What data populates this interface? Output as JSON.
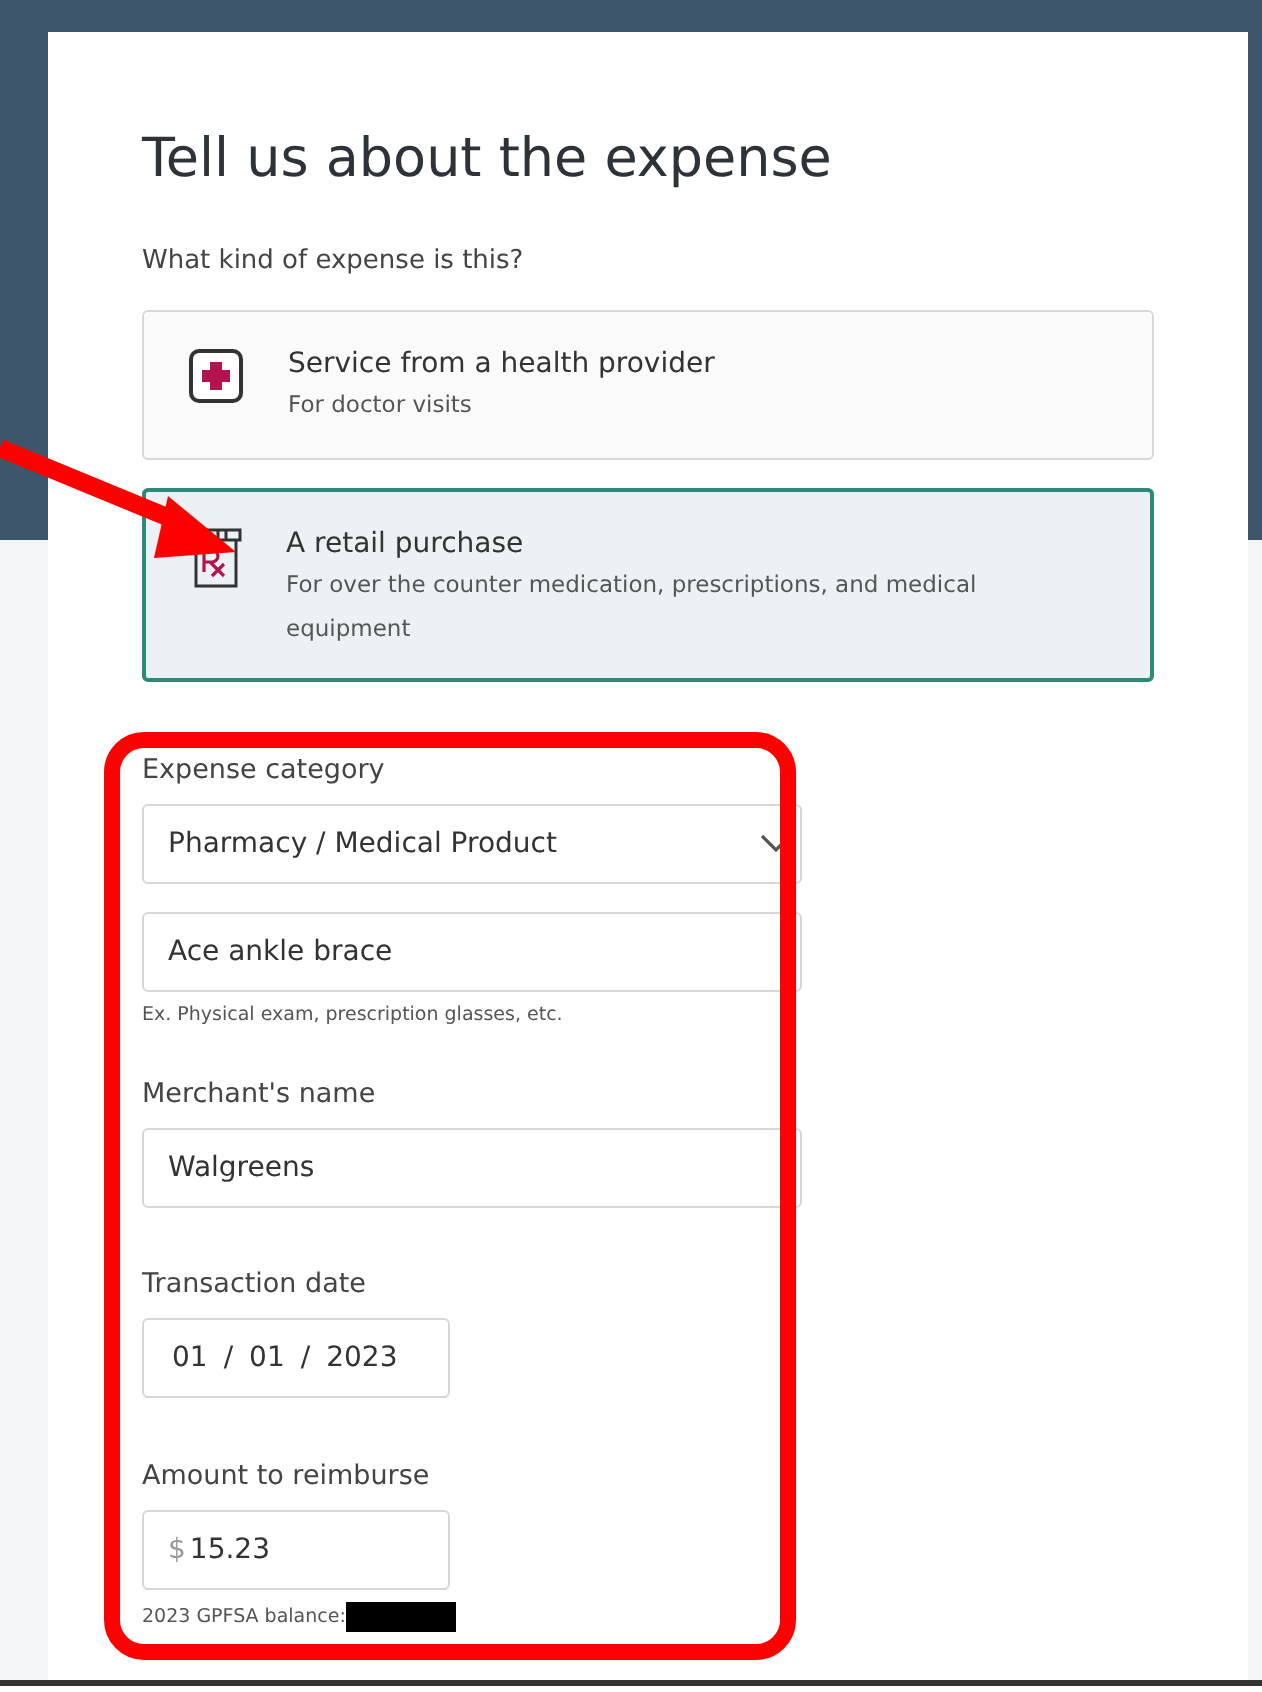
{
  "title": "Tell us about the expense",
  "question": "What kind of expense is this?",
  "options": [
    {
      "kind": "provider",
      "label": "Service from a health provider",
      "description": "For doctor visits",
      "selected": false
    },
    {
      "kind": "retail",
      "label": "A retail purchase",
      "description": "For over the counter medication, prescriptions, and medical equipment",
      "selected": true
    }
  ],
  "fields": [
    {
      "kind": "select",
      "label": "Expense category",
      "value": "Pharmacy / Medical Product"
    },
    {
      "kind": "text",
      "value": "Ace ankle brace",
      "hint": "Ex. Physical exam, prescription glasses, etc."
    },
    {
      "kind": "text",
      "label": "Merchant's name",
      "value": "Walgreens"
    },
    {
      "kind": "date",
      "label": "Transaction date",
      "month": "01",
      "day": "01",
      "year": "2023",
      "separator": "/"
    },
    {
      "kind": "currency",
      "label": "Amount to reimburse",
      "symbol": "$",
      "value": "15.23",
      "hint": "2023 GPFSA balance:",
      "redacted": true
    }
  ],
  "arrow_annotation": true,
  "frame_annotation": true
}
